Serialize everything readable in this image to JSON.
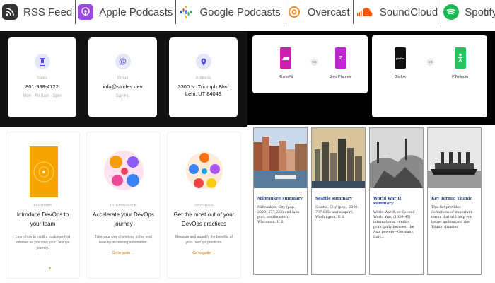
{
  "podcast_bar": {
    "items": [
      {
        "label": "RSS Feed",
        "icon": "rss-icon",
        "color": "#333333"
      },
      {
        "label": "Apple Podcasts",
        "icon": "apple-podcasts-icon",
        "color": "#9b4be0"
      },
      {
        "label": "Google Podcasts",
        "icon": "google-podcasts-icon",
        "color": "#4285f4"
      },
      {
        "label": "Overcast",
        "icon": "overcast-icon",
        "color": "#f48a1e"
      },
      {
        "label": "SoundCloud",
        "icon": "soundcloud-icon",
        "color": "#ff5500"
      },
      {
        "label": "Spotify",
        "icon": "spotify-icon",
        "color": "#1db954"
      }
    ]
  },
  "contact": {
    "cards": [
      {
        "label": "Sales",
        "value": "801-938-4722",
        "sub": "Mon - Fri 8am - 5pm",
        "icon": "phone-icon"
      },
      {
        "label": "Email",
        "value": "info@strides.dev",
        "sub": "Say Hi!",
        "icon": "at-icon"
      },
      {
        "label": "Address",
        "value": "3300 N. Triumph Blvd\nLehi, UT 84043",
        "sub": "",
        "icon": "location-pin-icon"
      }
    ]
  },
  "comparisons": [
    {
      "left": {
        "name": "RhinoFit",
        "color": "#d01fb0"
      },
      "vs": "VS",
      "right": {
        "name": "Zen Planner",
        "color": "#c026d3"
      }
    },
    {
      "left": {
        "name": "Glofox",
        "color": "#111111",
        "text": "glofox"
      },
      "vs": "VS",
      "right": {
        "name": "PTminder",
        "color": "#22c55e"
      }
    }
  ],
  "guides": {
    "cards": [
      {
        "level": "BEGINNER",
        "title": "Introduce DevOps to your team",
        "desc": "Learn how to instill a customer-first mindset as you start your DevOps journey.",
        "link": ""
      },
      {
        "level": "INTERMEDIATE",
        "title": "Accelerate your DevOps journey",
        "desc": "Take your way of working to the next level by increasing automation.",
        "link": "Go to guide →"
      },
      {
        "level": "ADVANCED",
        "title": "Get the most out of your DevOps practices",
        "desc": "Measure and quantify the benefits of your DevOps practices.",
        "link": "Go to guide →"
      }
    ]
  },
  "articles": [
    {
      "title": "Milwaukee summary",
      "desc": "Milwaukee, City (pop., 2020: 577,222) and lake port, southeastern Wisconsin, U.S."
    },
    {
      "title": "Seattle summary",
      "desc": "Seattle, City (pop., 2020: 737,015) and seaport, Washington, U.S."
    },
    {
      "title": "World War II summary",
      "desc": "World War II, or Second World War, (1939–45) international conflict principally between the Axis powers—Germany, Italy..."
    },
    {
      "title": "Key Terms: Titanic",
      "desc": "This list provides definitions of important terms that will help you better understand the Titanic disaster."
    }
  ]
}
